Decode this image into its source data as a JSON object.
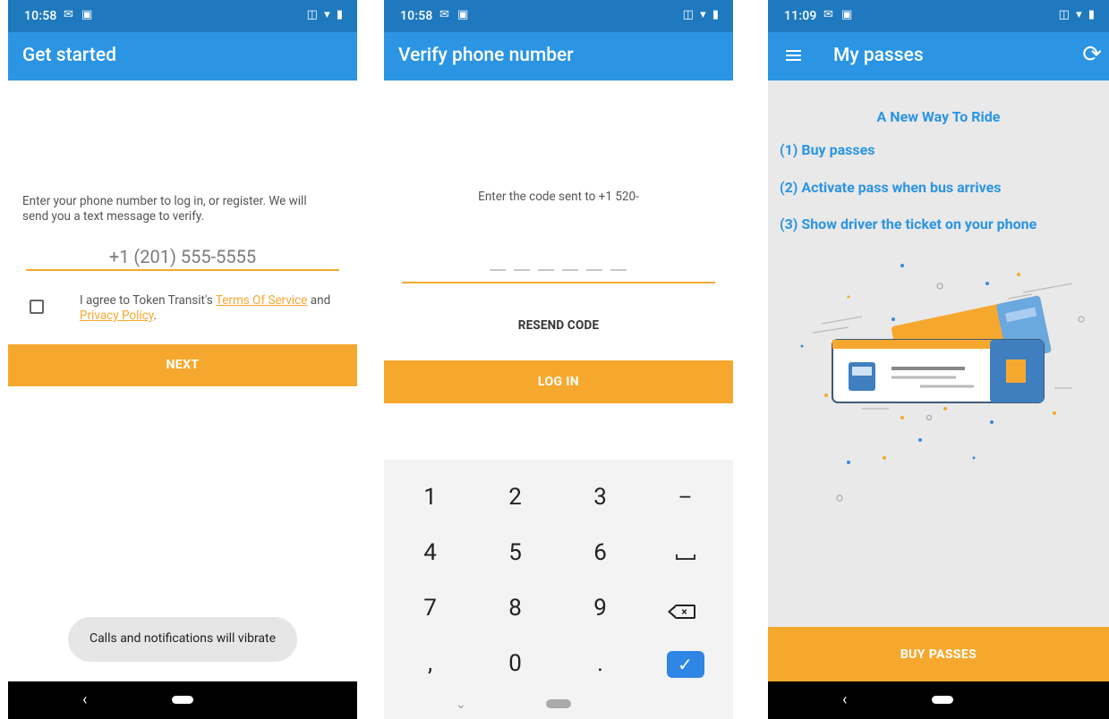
{
  "screens": {
    "get_started": {
      "status_time": "10:58",
      "title": "Get started",
      "instruction": "Enter your phone number to log in, or register. We will send you a text message to verify.",
      "phone_placeholder": "+1 (201) 555-5555",
      "agree_prefix": "I agree to Token Transit's ",
      "terms_link": "Terms Of Service",
      "agree_middle": " and ",
      "privacy_link": "Privacy Policy",
      "agree_suffix": ".",
      "next_button": "NEXT",
      "toast": "Calls and notifications will vibrate"
    },
    "verify": {
      "status_time": "10:58",
      "title": "Verify phone number",
      "instruction": "Enter the code sent to +1 520-",
      "resend_button": "RESEND CODE",
      "login_button": "LOG IN",
      "keypad": {
        "keys": [
          "1",
          "2",
          "3",
          "–",
          "4",
          "5",
          "6",
          "space",
          "7",
          "8",
          "9",
          "backspace",
          ",",
          "0",
          ".",
          "enter"
        ]
      }
    },
    "my_passes": {
      "status_time": "11:09",
      "title": "My passes",
      "heading": "A New Way To Ride",
      "steps": [
        "(1) Buy passes",
        "(2) Activate pass when bus arrives",
        "(3) Show driver the ticket on your phone"
      ],
      "buy_button": "BUY PASSES"
    }
  },
  "icons": {
    "status_notifications": "gmail-icon, sim-icon",
    "status_right": "vibrate-icon, wifi-icon, battery-icon",
    "menu": "menu-icon",
    "refresh": "refresh-icon",
    "back": "nav-back-icon",
    "home": "nav-home-icon",
    "keyboard_collapse": "chevron-down-icon"
  },
  "colors": {
    "statusbar": "#1f79bf",
    "appbar": "#2b95e3",
    "accent_orange": "#f6a82e",
    "enter_key": "#2f86e4",
    "text_blue": "#2b95e3"
  }
}
